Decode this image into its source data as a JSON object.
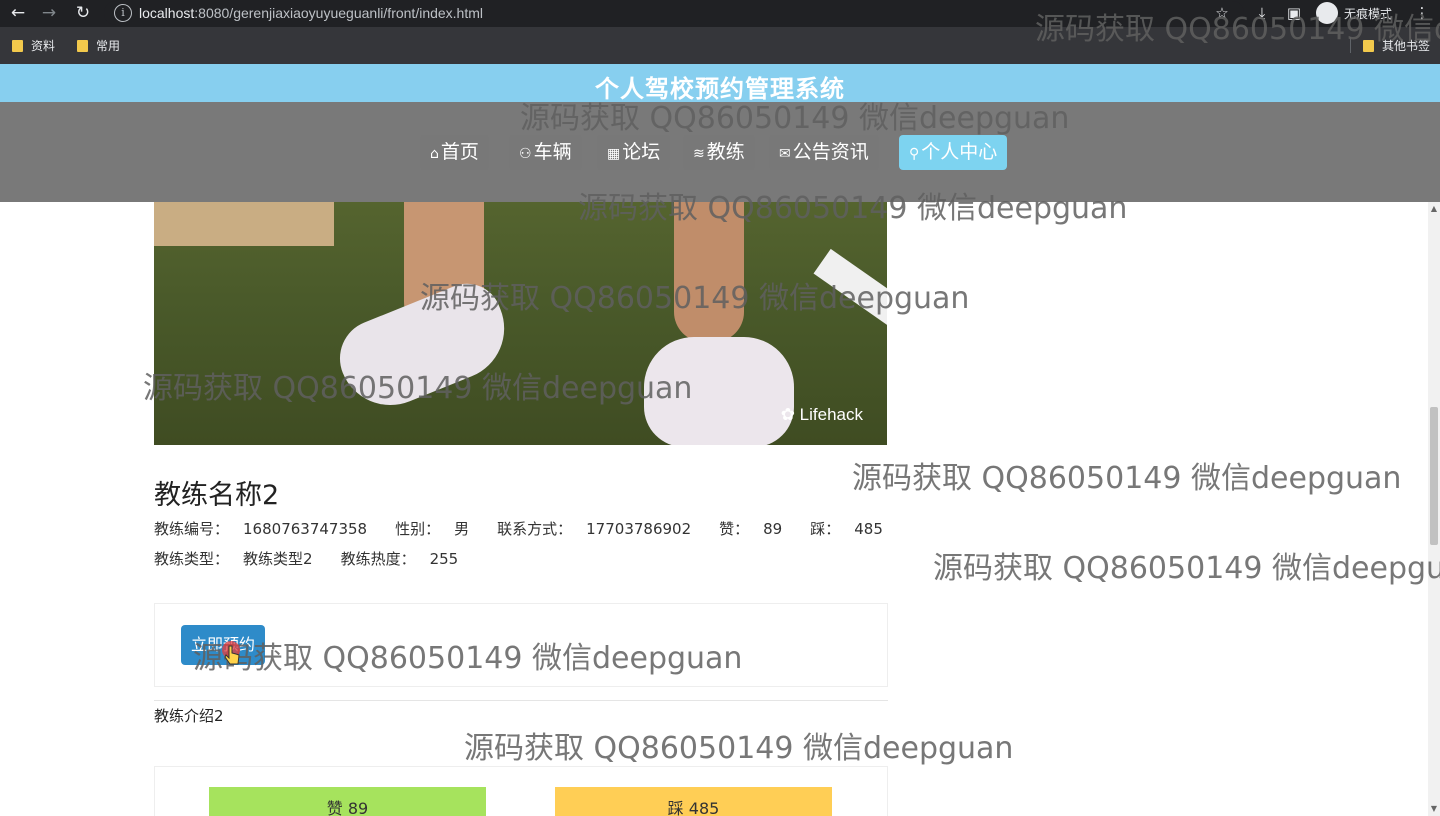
{
  "browser": {
    "url_host": "localhost",
    "url_rest": ":8080/gerenjiaxiaoyuyueguanli/front/index.html",
    "incognito_label": "无痕模式",
    "bookmarks": [
      "资料",
      "常用"
    ],
    "other_bookmarks": "其他书签"
  },
  "site": {
    "title": "个人驾校预约管理系统",
    "nav": [
      {
        "icon": "⌂",
        "label": "首页"
      },
      {
        "icon": "⚇",
        "label": "车辆"
      },
      {
        "icon": "▦",
        "label": "论坛"
      },
      {
        "icon": "≋",
        "label": "教练"
      },
      {
        "icon": "✉",
        "label": "公告资讯"
      },
      {
        "icon": "⚲",
        "label": "个人中心"
      }
    ]
  },
  "photo": {
    "brand": "Lifehack"
  },
  "coach": {
    "name": "教练名称2",
    "number_label": "教练编号：",
    "number": "1680763747358",
    "gender_label": "性别：",
    "gender": "男",
    "contact_label": "联系方式：",
    "contact": "17703786902",
    "likes_label": "赞：",
    "likes": "89",
    "dislikes_label": "踩：",
    "dislikes": "485",
    "type_label": "教练类型：",
    "type": "教练类型2",
    "heat_label": "教练热度：",
    "heat": "255",
    "intro": "教练介绍2"
  },
  "actions": {
    "book_label": "立即预约",
    "like_label": "赞 89",
    "dislike_label": "踩 485"
  },
  "watermark": "源码获取 QQ86050149 微信deepguan",
  "colors": {
    "title_bar": "#87cfef",
    "nav_active": "#7dd3f0",
    "book_button": "#2e8bc9",
    "like": "#a6e35d",
    "dislike": "#ffce55"
  }
}
